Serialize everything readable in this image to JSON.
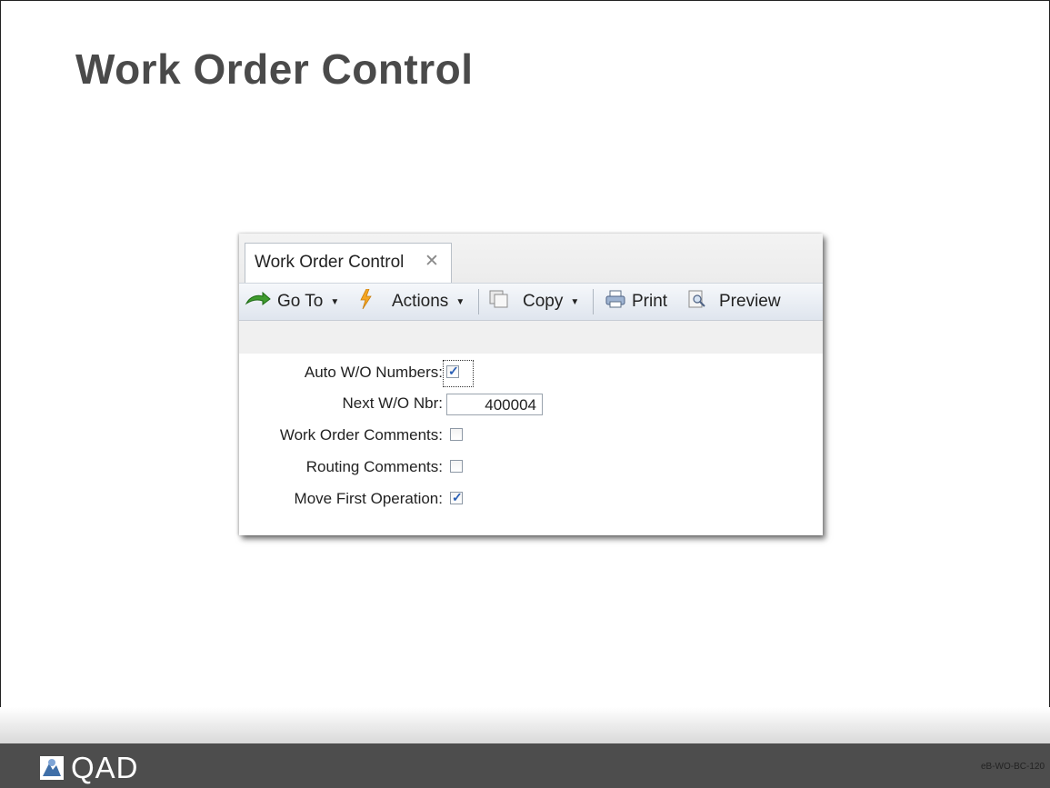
{
  "slide": {
    "title": "Work Order Control",
    "code": "eB-WO-BC-120"
  },
  "window": {
    "tab_label": "Work Order Control",
    "tab_close": "✕"
  },
  "toolbar": {
    "goto_label": "Go To",
    "actions_label": "Actions",
    "copy_label": "Copy",
    "print_label": "Print",
    "preview_label": "Preview"
  },
  "form": {
    "auto_wo_label": "Auto W/O Numbers:",
    "auto_wo_checked": true,
    "next_wo_label": "Next W/O Nbr:",
    "next_wo_value": "400004",
    "wo_comments_label": "Work Order Comments:",
    "wo_comments_checked": false,
    "routing_comments_label": "Routing Comments:",
    "routing_comments_checked": false,
    "move_first_label": "Move First Operation:",
    "move_first_checked": true
  },
  "footer": {
    "logo_text": "QAD"
  },
  "colors": {
    "title": "#4a4a4a",
    "footer": "#4d4d4d",
    "check": "#2a5fb5"
  }
}
